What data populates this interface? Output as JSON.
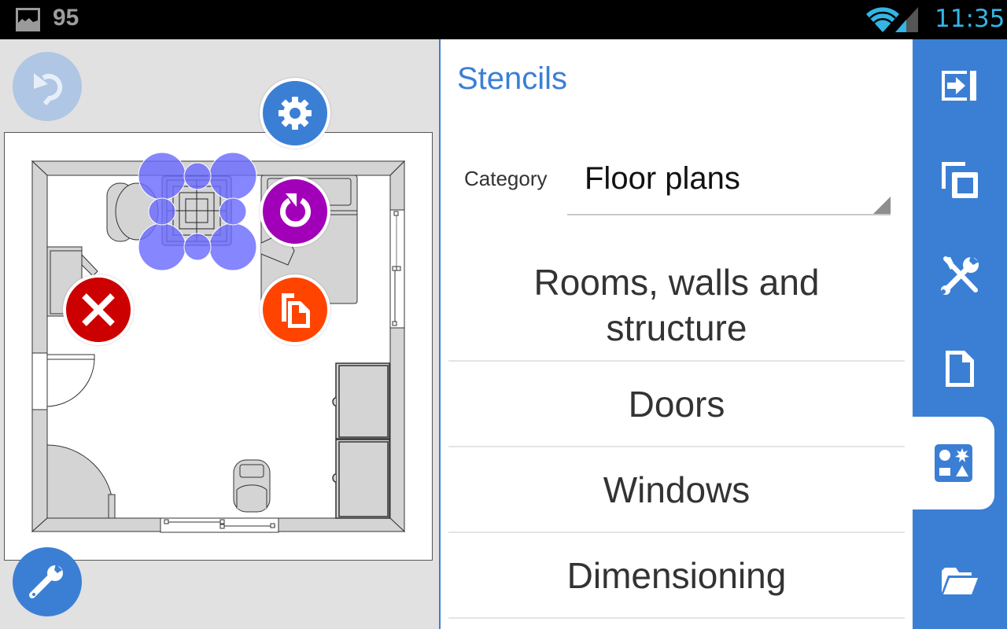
{
  "status_bar": {
    "notification_icon": "image-icon",
    "battery_level": "95",
    "wifi_icon": "wifi-icon",
    "signal_icon": "signal-icon",
    "time": "11:35",
    "time_color": "#33b5e5"
  },
  "canvas": {
    "undo_icon": "undo-icon",
    "settings_icon": "gear-icon",
    "rotate_icon": "rotate-icon",
    "delete_icon": "close-icon",
    "duplicate_icon": "duplicate-icon",
    "tools_icon": "wrench-icon",
    "colors": {
      "undo_disabled": "#afc6e4",
      "settings": "#3b7fd5",
      "rotate": "#a100b8",
      "delete": "#cc0000",
      "duplicate": "#ff4400",
      "selection": "#6b6bff"
    }
  },
  "stencils": {
    "title": "Stencils",
    "category_label": "Category",
    "category_value": "Floor plans",
    "items": [
      {
        "label": "Rooms, walls and structure"
      },
      {
        "label": "Doors"
      },
      {
        "label": "Windows"
      },
      {
        "label": "Dimensioning"
      }
    ]
  },
  "toolbar": {
    "accent": "#3b7fd5",
    "buttons": [
      {
        "name": "exit-icon",
        "active": false
      },
      {
        "name": "copy-pages-icon",
        "active": false
      },
      {
        "name": "tools-icon",
        "active": false
      },
      {
        "name": "document-icon",
        "active": false
      },
      {
        "name": "stencils-icon",
        "active": true
      },
      {
        "name": "folder-open-icon",
        "active": false
      }
    ]
  }
}
